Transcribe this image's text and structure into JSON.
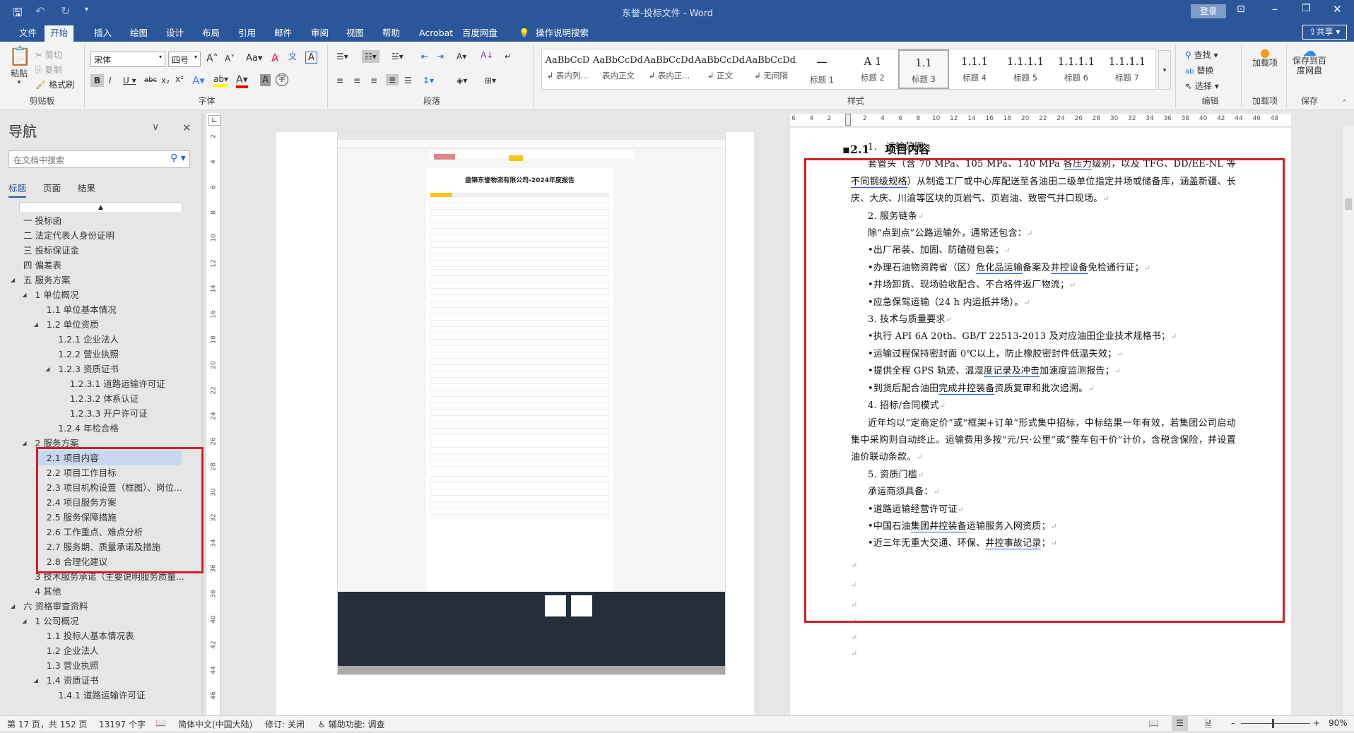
{
  "titlebar": {
    "title": "东誉-投标文件  -  Word",
    "login": "登录",
    "share": "共享"
  },
  "tabs": [
    "文件",
    "开始",
    "插入",
    "绘图",
    "设计",
    "布局",
    "引用",
    "邮件",
    "审阅",
    "视图",
    "帮助",
    "Acrobat",
    "百度网盘"
  ],
  "tell_me": "操作说明搜索",
  "ribbon": {
    "clipboard": {
      "label": "剪贴板",
      "paste": "粘贴",
      "cut": "剪切",
      "copy": "复制",
      "format_painter": "格式刷"
    },
    "font": {
      "label": "字体",
      "font_name": "宋体",
      "font_size": "四号"
    },
    "paragraph": {
      "label": "段落"
    },
    "styles": {
      "label": "样式",
      "items": [
        {
          "preview": "AaBbCcD",
          "name": "↲ 表内列..."
        },
        {
          "preview": "AaBbCcDdI",
          "name": "表内正文"
        },
        {
          "preview": "AaBbCcDdI",
          "name": "↲ 表内正..."
        },
        {
          "preview": "AaBbCcDdI",
          "name": "↲ 正文"
        },
        {
          "preview": "AaBbCcDdI",
          "name": "↲ 无间隔"
        },
        {
          "preview": "一",
          "name": "标题 1"
        },
        {
          "preview": "A 1",
          "name": "标题 2"
        },
        {
          "preview": "1.1",
          "name": "标题 3"
        },
        {
          "preview": "1.1.1",
          "name": "标题 4"
        },
        {
          "preview": "1.1.1.1",
          "name": "标题 5"
        },
        {
          "preview": "1.1.1.1",
          "name": "标题 6"
        },
        {
          "preview": "1.1.1.1",
          "name": "标题 7"
        }
      ],
      "selected": "标题 3"
    },
    "editing": {
      "label": "编辑",
      "find": "查找",
      "replace": "替换",
      "select": "选择"
    },
    "addins": {
      "label": "加载项",
      "button": "加载项"
    },
    "save": {
      "label": "保存",
      "button": "保存到百度网盘"
    }
  },
  "nav": {
    "title": "导航",
    "search_placeholder": "在文档中搜索",
    "tabs": [
      "标题",
      "页面",
      "结果"
    ],
    "items": [
      {
        "t": "一 投标函",
        "l": 0
      },
      {
        "t": "二 法定代表人身份证明",
        "l": 0
      },
      {
        "t": "三 投标保证金",
        "l": 0
      },
      {
        "t": "四 偏差表",
        "l": 0
      },
      {
        "t": "五 服务方案",
        "l": 0,
        "exp": true
      },
      {
        "t": "1 单位概况",
        "l": 1,
        "exp": true
      },
      {
        "t": "1.1 单位基本情况",
        "l": 2
      },
      {
        "t": "1.2 单位资质",
        "l": 2,
        "exp": true
      },
      {
        "t": "1.2.1 企业法人",
        "l": 3
      },
      {
        "t": "1.2.2 营业执照",
        "l": 3
      },
      {
        "t": "1.2.3 资质证书",
        "l": 3,
        "exp": true
      },
      {
        "t": "1.2.3.1 道路运输许可证",
        "l": 4
      },
      {
        "t": "1.2.3.2 体系认证",
        "l": 4
      },
      {
        "t": "1.2.3.3 开户许可证",
        "l": 4
      },
      {
        "t": "1.2.4 年检合格",
        "l": 3
      },
      {
        "t": "2 服务方案",
        "l": 1,
        "exp": true
      },
      {
        "t": "2.1 项目内容",
        "l": 2,
        "sel": true
      },
      {
        "t": "2.2 项目工作目标",
        "l": 2
      },
      {
        "t": "2.3 项目机构设置（框图）、岗位...",
        "l": 2
      },
      {
        "t": "2.4 项目服务方案",
        "l": 2
      },
      {
        "t": "2.5 服务保障措施",
        "l": 2
      },
      {
        "t": "2.6 工作重点、难点分析",
        "l": 2
      },
      {
        "t": "2.7 服务期、质量承诺及措施",
        "l": 2
      },
      {
        "t": "2.8 合理化建议",
        "l": 2
      },
      {
        "t": "3 技术服务承诺（主要说明服务质量...",
        "l": 1
      },
      {
        "t": "4 其他",
        "l": 1
      },
      {
        "t": "六 资格审查资料",
        "l": 0,
        "exp": true
      },
      {
        "t": "1 公司概况",
        "l": 1,
        "exp": true
      },
      {
        "t": "1.1 投标人基本情况表",
        "l": 2
      },
      {
        "t": "1.2 企业法人",
        "l": 2
      },
      {
        "t": "1.3 营业执照",
        "l": 2
      },
      {
        "t": "1.4 资质证书",
        "l": 2,
        "exp": true
      },
      {
        "t": "1.4.1 道路运输许可证",
        "l": 3
      }
    ]
  },
  "hruler": [
    "6",
    "4",
    "2",
    "",
    "2",
    "4",
    "6",
    "8",
    "10",
    "12",
    "14",
    "16",
    "18",
    "20",
    "22",
    "24",
    "26",
    "28",
    "30",
    "32",
    "34",
    "36",
    "38",
    "40",
    "42",
    "44",
    "46",
    "48"
  ],
  "vruler": [
    "2",
    "4",
    "6",
    "8",
    "10",
    "12",
    "14",
    "16",
    "18",
    "20",
    "22",
    "24",
    "26",
    "28",
    "30",
    "32",
    "34",
    "36",
    "38",
    "40",
    "42",
    "44",
    "46"
  ],
  "embedded": {
    "report_title": "盘锦东誉物流有限公司-2024年度报告"
  },
  "document": {
    "heading": "▪2.1　 项目内容",
    "paragraphs": [
      [
        {
          "t": "1.　运输范围"
        }
      ],
      [
        {
          "t": "套管头（含 70 MPa、105 MPa、140 MPa "
        },
        {
          "t": "各压力",
          "u": 1
        },
        {
          "t": "级别，以及 TFG、DD/EE-NL 等"
        },
        {
          "t": "不同钢级规格",
          "u": 1
        },
        {
          "t": "）从制造工厂或中心库配送至各油田二级单位指定井场或储备库，涵盖新疆、长庆、大庆、川渝等区块的页岩气、页岩油、致密气井口现场。"
        }
      ],
      [
        {
          "t": "2. 服务链条"
        }
      ],
      [
        {
          "t": "除“点到点”公路运输外，通常还包含："
        }
      ],
      [
        {
          "t": "•出厂吊装、加固、防磕碰包装；"
        }
      ],
      [
        {
          "t": "•办理石油物资跨省（区）"
        },
        {
          "t": "危化品运输",
          "u": 1
        },
        {
          "t": "备案及"
        },
        {
          "t": "井控设备",
          "u": 1
        },
        {
          "t": "免检通行证；"
        }
      ],
      [
        {
          "t": "•井场卸货、现场验收配合、不合格件返厂物流；"
        }
      ],
      [
        {
          "t": "•应急保驾运输（24 h 内运抵井场）。"
        }
      ],
      [
        {
          "t": "3. 技术与质量要求"
        }
      ],
      [
        {
          "t": "•执行 API 6A 20th、GB/T 22513-2013 及对应油田企业技术规格书；"
        }
      ],
      [
        {
          "t": "•运输过程保持密封面 0℃以上，防止橡胶密封件低温失效；"
        }
      ],
      [
        {
          "t": "•提供全程 GPS 轨迹、温湿"
        },
        {
          "t": "度记录及冲击",
          "u": 1
        },
        {
          "t": "加速度监测报告；"
        }
      ],
      [
        {
          "t": "•到货后配合油田"
        },
        {
          "t": "完成井控装备",
          "u": 1
        },
        {
          "t": "资质复审和批次追溯。"
        }
      ],
      [
        {
          "t": "4. 招标/合同模式"
        }
      ],
      [
        {
          "t": "近年均以“定商定价”或“框架+订单”形式集中招标，中标结果一年有效，若集团公司启动集中采购则自动终止。运输费用多按“元/只·公里”或“整车包干价”计价，含税含保险，并设置油价联动条款。"
        }
      ],
      [
        {
          "t": "5. 资质门槛"
        }
      ],
      [
        {
          "t": "承运商须具备："
        }
      ],
      [
        {
          "t": "•道路运输经营许可证"
        }
      ],
      [
        {
          "t": "•中国石油"
        },
        {
          "t": "集团井控装备",
          "u": 1
        },
        {
          "t": "运输服务入网资质；"
        }
      ],
      [
        {
          "t": "•近三年无重大交通、环保、"
        },
        {
          "t": "井控事故记录",
          "u": 1
        },
        {
          "t": "；"
        }
      ]
    ],
    "empty_paragraphs": 6
  },
  "statusbar": {
    "page": "第 17 页，共 152 页",
    "words": "13197 个字",
    "language": "简体中文(中国大陆)",
    "track": "修订: 关闭",
    "accessibility": "辅助功能: 调查",
    "zoom": "90%"
  },
  "colors": {
    "title_bar": "#2b579a",
    "highlight_box": "#d11f2a",
    "nav_selected": "#c5d7f1"
  }
}
